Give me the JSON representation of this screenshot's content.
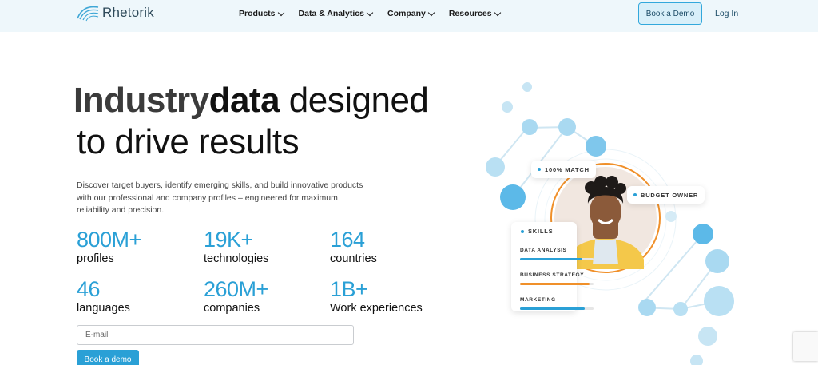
{
  "header": {
    "brand": "Rhetorik",
    "nav": [
      "Products",
      "Data & Analytics",
      "Company",
      "Resources"
    ],
    "demo_label": "Book a Demo",
    "login_label": "Log In"
  },
  "hero": {
    "headline_ghost": "Industry",
    "headline_bold": "data",
    "headline_rest": " designed",
    "headline_line2": "to drive results",
    "description": "Discover target buyers, identify emerging skills, and build innovative products with our professional and company profiles – engineered for maximum reliability and precision."
  },
  "stats": [
    {
      "value": "800M+",
      "label": "profiles"
    },
    {
      "value": "19K+",
      "label": "technologies"
    },
    {
      "value": "164",
      "label": "countries"
    },
    {
      "value": "46",
      "label": "languages"
    },
    {
      "value": "260M+",
      "label": "companies"
    },
    {
      "value": "1B+",
      "label": "Work experiences"
    }
  ],
  "form": {
    "email_placeholder": "E-mail",
    "cta_label": "Book a demo"
  },
  "illustration": {
    "badge_match": "100% MATCH",
    "badge_owner": "BUDGET OWNER",
    "skills_title": "SKILLS",
    "skills": [
      {
        "label": "DATA ANALYSIS",
        "level": 0.85,
        "color": "#2aa0d6"
      },
      {
        "label": "BUSINESS STRATEGY",
        "level": 0.95,
        "color": "#f0902a"
      },
      {
        "label": "MARKETING",
        "level": 0.88,
        "color": "#2aa0d6"
      }
    ],
    "accent_blue": "#2aa0d6",
    "accent_orange": "#f0902a"
  }
}
